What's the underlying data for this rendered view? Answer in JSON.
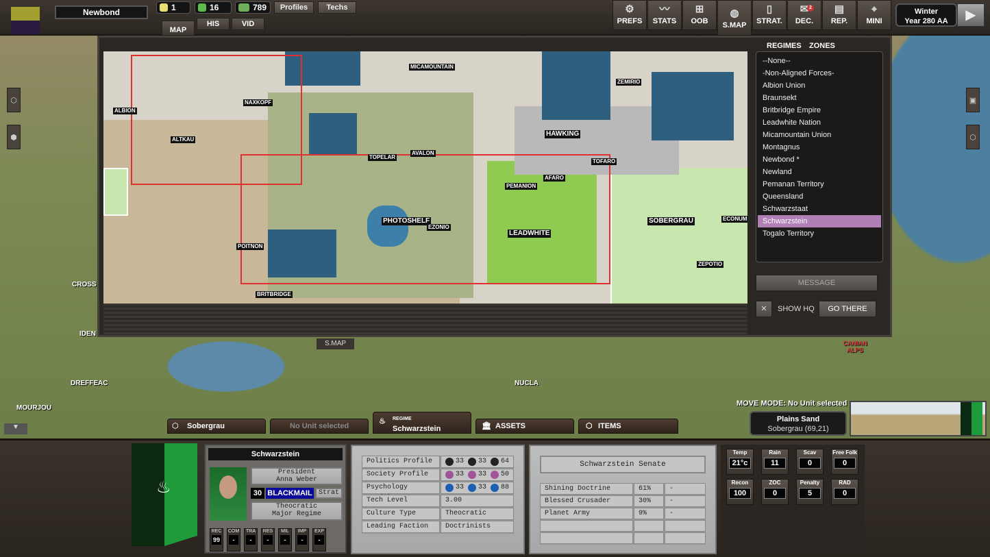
{
  "header": {
    "regime_name": "Newbond",
    "resources": [
      {
        "icon": "sun-icon",
        "value": "1",
        "color": "#e8e070"
      },
      {
        "icon": "fist-icon",
        "value": "16",
        "color": "#5dbb4e"
      },
      {
        "icon": "money-icon",
        "value": "789",
        "color": "#6fae5a"
      }
    ],
    "profiles_label": "Profiles",
    "techs_label": "Techs",
    "view_tabs": [
      "MAP",
      "HIS",
      "VID"
    ],
    "menu": [
      {
        "label": "PREFS",
        "icon": "gear-icon",
        "glyph": "⚙"
      },
      {
        "label": "STATS",
        "icon": "chart-icon",
        "glyph": "📈"
      },
      {
        "label": "OOB",
        "icon": "hierarchy-icon",
        "glyph": "⊞"
      },
      {
        "label": "S.MAP",
        "icon": "globe-icon",
        "glyph": "◍"
      },
      {
        "label": "STRAT.",
        "icon": "cards-icon",
        "glyph": "▯"
      },
      {
        "label": "DEC.",
        "icon": "envelope-icon",
        "glyph": "✉",
        "badge": "2"
      },
      {
        "label": "REP.",
        "icon": "report-icon",
        "glyph": "▤"
      },
      {
        "label": "MINI",
        "icon": "map-pin-icon",
        "glyph": "⌖"
      }
    ],
    "season": "Winter",
    "year": "Year 280 AA"
  },
  "strategic_map": {
    "cities": [
      {
        "name": "ALBION"
      },
      {
        "name": "NAXKOPF"
      },
      {
        "name": "ALTKAU"
      },
      {
        "name": "MICAMOUNTAIN"
      },
      {
        "name": "ZEMIRIO"
      },
      {
        "name": "HAWKING"
      },
      {
        "name": "TOFARO"
      },
      {
        "name": "TOPELAR"
      },
      {
        "name": "AVALON"
      },
      {
        "name": "PEMANION"
      },
      {
        "name": "AFARO"
      },
      {
        "name": "PHOTOSHELF"
      },
      {
        "name": "EZONIO"
      },
      {
        "name": "LEADWHITE"
      },
      {
        "name": "SOBERGRAU"
      },
      {
        "name": "ECONUM"
      },
      {
        "name": "POITNON"
      },
      {
        "name": "ZEPOTIO"
      },
      {
        "name": "BRITBRIDGE"
      }
    ],
    "tab_label": "S.MAP"
  },
  "regimes_panel": {
    "tabs": [
      "REGIMES",
      "ZONES"
    ],
    "items": [
      "--None--",
      "-Non-Aligned Forces-",
      "Albion Union",
      "Braunsekt",
      "Britbridge Empire",
      "Leadwhite Nation",
      "Micamountain Union",
      "Montagnus",
      "Newbond *",
      "Newland",
      "Pemanan Territory",
      "Queensland",
      "Schwarzstaat",
      "Schwarzstein",
      "Togalo Territory"
    ],
    "selected": "Schwarzstein",
    "message_label": "MESSAGE",
    "show_hq_label": "SHOW HQ",
    "go_there_label": "GO THERE"
  },
  "world_labels": [
    "CROSS",
    "IDEN",
    "DREFFEAC",
    "MOURJOU",
    "NUCLA",
    "CANIAN ALPS"
  ],
  "bottom_tabs": {
    "hex": "Sobergrau",
    "unit": "No Unit selected",
    "regime_caption": "REGIME",
    "regime": "Schwarzstein",
    "assets": "ASSETS",
    "items": "ITEMS"
  },
  "move_mode": "MOVE MODE: No Unit selected",
  "terrain": {
    "name": "Plains Sand",
    "location": "Sobergrau (69,21)"
  },
  "regime_card": {
    "name": "Schwarzstein",
    "leader_title": "President",
    "leader_name": "Anna Weber",
    "points": "30",
    "action": "BLACKMAIL",
    "strat": "Strat",
    "type_line1": "Theocratic",
    "type_line2": "Major Regime",
    "flag_colors": [
      "#1e9a3a",
      "#0c2a12"
    ],
    "stats": [
      {
        "label": "REC",
        "value": "99"
      },
      {
        "label": "COM",
        "value": "-"
      },
      {
        "label": "TRA",
        "value": "-"
      },
      {
        "label": "RES",
        "value": "-"
      },
      {
        "label": "MIL",
        "value": "-"
      },
      {
        "label": "IMP",
        "value": "-"
      },
      {
        "label": "EXP",
        "value": "-"
      }
    ]
  },
  "profile_table": {
    "rows": [
      {
        "label": "Politics Profile",
        "values": [
          "33",
          "33",
          "64"
        ],
        "icons": [
          "star-icon",
          "crown-icon",
          "pillar-icon"
        ],
        "color": "#222"
      },
      {
        "label": "Society Profile",
        "values": [
          "33",
          "33",
          "50"
        ],
        "icons": [
          "eye-icon",
          "people-icon",
          "hammer-sickle-icon"
        ],
        "color": "#a0559a"
      },
      {
        "label": "Psychology Profile",
        "values": [
          "33",
          "33",
          "88"
        ],
        "icons": [
          "pen-icon",
          "graduation-cap-icon",
          "family-icon"
        ],
        "color": "#1d5fb0"
      },
      {
        "label": "Tech Level",
        "value": "3.00"
      },
      {
        "label": "Culture Type",
        "value": "Theocratic"
      },
      {
        "label": "Leading Faction",
        "value": "Doctrinists"
      }
    ]
  },
  "senate": {
    "title": "Schwarzstein Senate",
    "rows": [
      {
        "name": "Shining Doctrine School",
        "pct": "61%",
        "extra": "-"
      },
      {
        "name": "Blessed Crusader Knights",
        "pct": "30%",
        "extra": "-"
      },
      {
        "name": "Planet Army",
        "pct": "9%",
        "extra": "-"
      }
    ]
  },
  "hex_stats": [
    {
      "label": "Temp",
      "value": "21°c"
    },
    {
      "label": "Rain",
      "value": "11"
    },
    {
      "label": "Scav",
      "value": "0"
    },
    {
      "label": "Free Folk",
      "value": "0"
    },
    {
      "label": "Recon",
      "value": "100"
    },
    {
      "label": "ZOC",
      "value": "0"
    },
    {
      "label": "Penalty",
      "value": "5"
    },
    {
      "label": "RAD",
      "value": "0"
    }
  ]
}
